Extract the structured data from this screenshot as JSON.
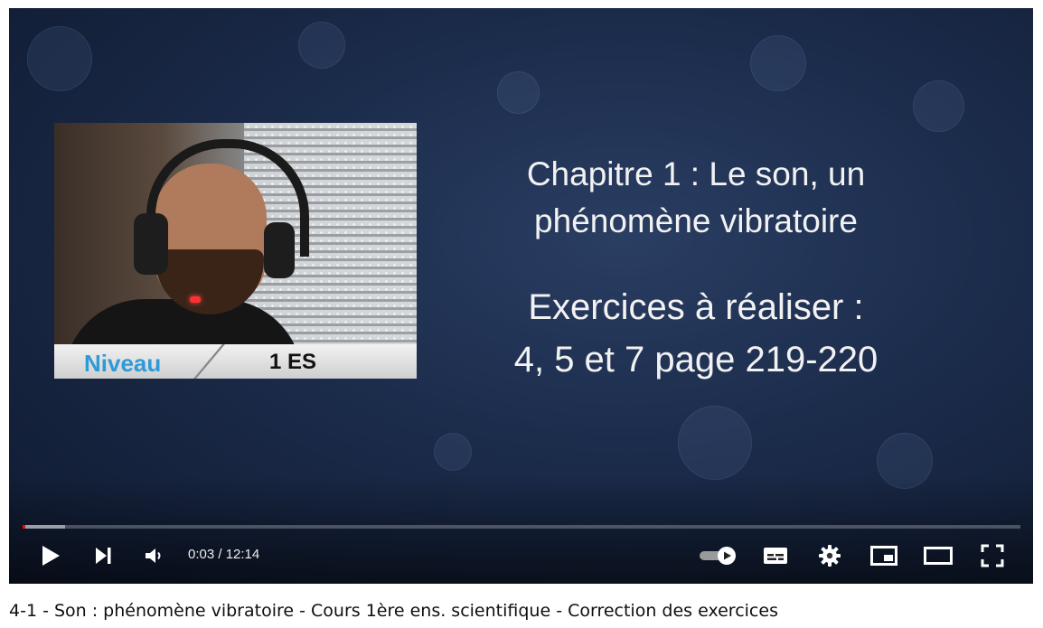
{
  "video": {
    "slide_heading_line1": "Chapitre 1 : Le son, un",
    "slide_heading_line2": "phénomène vibratoire",
    "slide_exercises_line1": "Exercices à réaliser :",
    "slide_exercises_line2": "4, 5 et 7 page 219-220",
    "overlay_level_label": "Niveau",
    "overlay_level_value": "1 ES"
  },
  "player": {
    "time_display": "0:03 / 12:14",
    "progress_played_fraction": 0.003,
    "progress_loaded_fraction": 0.043,
    "colors": {
      "progress_played": "#ff0000",
      "level_label": "#2f9ad8"
    },
    "icons": [
      "play-icon",
      "next-icon",
      "volume-icon",
      "autoplay-toggle-icon",
      "subtitles-icon",
      "settings-gear-icon",
      "miniplayer-icon",
      "theater-mode-icon",
      "fullscreen-icon"
    ]
  },
  "title": "4-1 - Son : phénomène vibratoire - Cours 1ère ens. scientifique - Correction des exercices"
}
